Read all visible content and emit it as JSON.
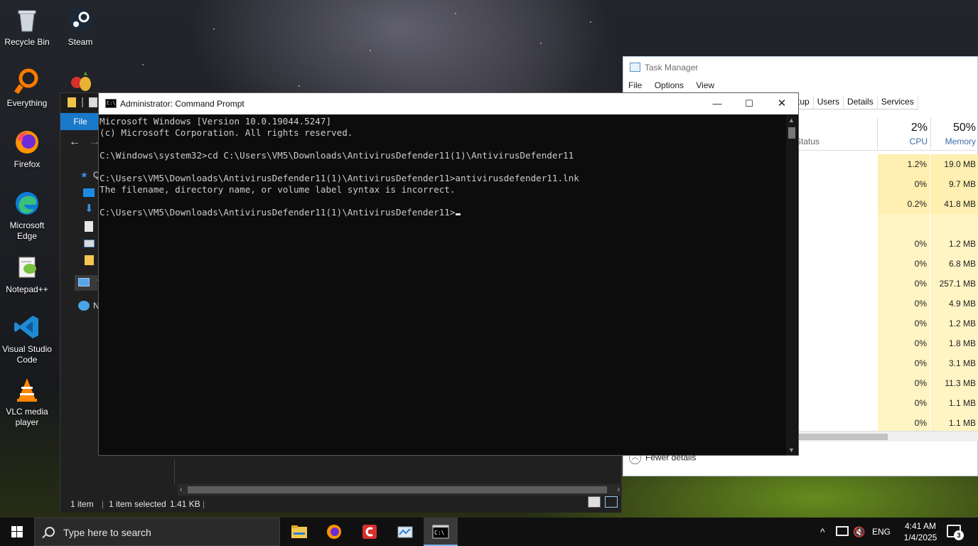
{
  "desktop": {
    "icons": [
      {
        "label": "Recycle Bin",
        "icon": "recycle-bin-icon"
      },
      {
        "label": "Steam",
        "icon": "steam-icon"
      },
      {
        "label": "Everything",
        "icon": "everything-search-icon"
      },
      {
        "label": "Firefox",
        "icon": "firefox-icon"
      },
      {
        "label": "Microsoft Edge",
        "icon": "edge-icon"
      },
      {
        "label": "Notepad++",
        "icon": "notepad-plus-plus-icon"
      },
      {
        "label": "Visual Studio Code",
        "icon": "vscode-icon"
      },
      {
        "label": "VLC media player",
        "icon": "vlc-icon"
      }
    ]
  },
  "task_manager": {
    "title": "Task Manager",
    "menu": [
      "File",
      "Options",
      "View"
    ],
    "tabs": [
      "tup",
      "Users",
      "Details",
      "Services"
    ],
    "status_header": "Status",
    "cpu_pct": "2%",
    "cpu_label": "CPU",
    "mem_pct": "50%",
    "mem_label": "Memory",
    "rows": [
      {
        "cpu": "1.2%",
        "mem": "19.0 MB"
      },
      {
        "cpu": "0%",
        "mem": "9.7 MB"
      },
      {
        "cpu": "0.2%",
        "mem": "41.8 MB"
      },
      {
        "cpu": "",
        "mem": ""
      },
      {
        "cpu": "0%",
        "mem": "1.2 MB"
      },
      {
        "cpu": "0%",
        "mem": "6.8 MB"
      },
      {
        "cpu": "0%",
        "mem": "257.1 MB"
      },
      {
        "cpu": "0%",
        "mem": "4.9 MB"
      },
      {
        "cpu": "0%",
        "mem": "1.2 MB"
      },
      {
        "cpu": "0%",
        "mem": "1.8 MB"
      },
      {
        "cpu": "0%",
        "mem": "3.1 MB"
      },
      {
        "cpu": "0%",
        "mem": "11.3 MB"
      },
      {
        "cpu": "0%",
        "mem": "1.1 MB"
      },
      {
        "cpu": "0%",
        "mem": "1.1 MB"
      }
    ],
    "fewer_details": "Fewer details"
  },
  "explorer": {
    "file_tab": "File",
    "nav_labels": [
      "Q",
      "Th",
      "N"
    ],
    "status_items": "1 item",
    "status_selected": "1 item selected",
    "status_size": "1.41 KB"
  },
  "cmd": {
    "title": "Administrator: Command Prompt",
    "icon_text": "C:\\",
    "lines": [
      "Microsoft Windows [Version 10.0.19044.5247]",
      "(c) Microsoft Corporation. All rights reserved.",
      "",
      "C:\\Windows\\system32>cd C:\\Users\\VM5\\Downloads\\AntivirusDefender11(1)\\AntivirusDefender11",
      "",
      "C:\\Users\\VM5\\Downloads\\AntivirusDefender11(1)\\AntivirusDefender11>antivirusdefender11.lnk",
      "The filename, directory name, or volume label syntax is incorrect.",
      "",
      "C:\\Users\\VM5\\Downloads\\AntivirusDefender11(1)\\AntivirusDefender11>"
    ],
    "minimize": "—",
    "maximize": "☐",
    "close": "✕"
  },
  "taskbar": {
    "search_placeholder": "Type here to search",
    "pinned": [
      "file-explorer-icon",
      "firefox-icon",
      "ccleaner-icon",
      "task-manager-icon",
      "command-prompt-icon"
    ],
    "tray": {
      "chevron": "^",
      "lang": "ENG",
      "time": "4:41 AM",
      "date": "1/4/2025",
      "notifications": "3"
    }
  },
  "colors": {
    "accent": "#1979ca",
    "console_bg": "#0c0c0c",
    "console_text": "#cccccc",
    "heat": "#fff4c4"
  }
}
